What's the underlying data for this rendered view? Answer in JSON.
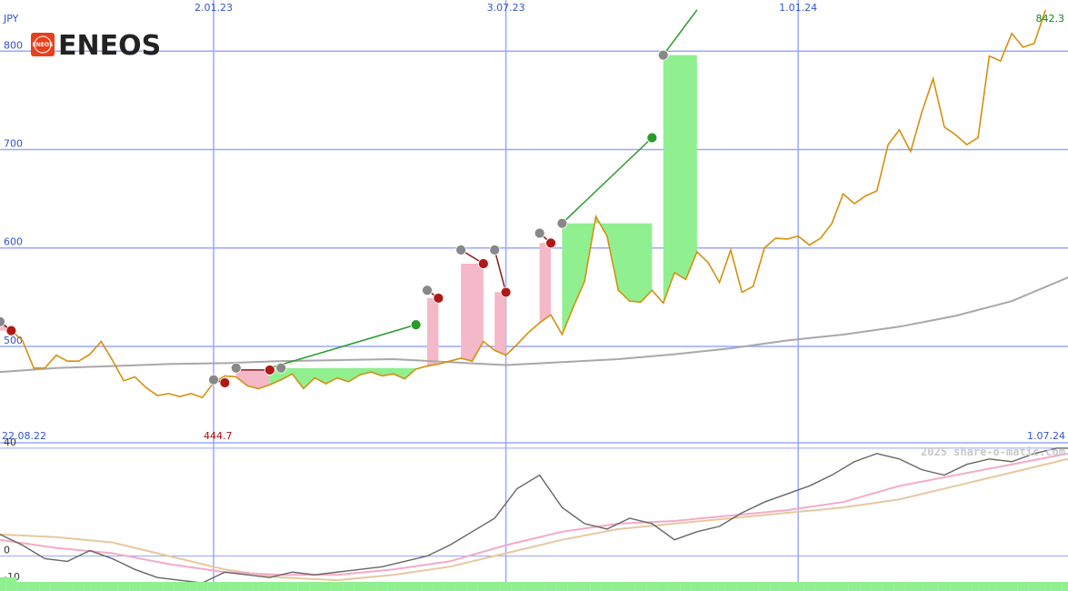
{
  "logo": {
    "badge_text": "ENEOS",
    "wordmark": "ENEOS",
    "badge_color": "#e8401c"
  },
  "currency": "JPY",
  "watermark": "2025 share-o-matic.com",
  "colors": {
    "price": "#d4900e",
    "ma_slow": "#a8a8a8",
    "grid": "#98a8ff",
    "gain_fill": "#90f090",
    "loss_fill": "#f4b8c8",
    "trend_up": "#2a9a2a",
    "trend_down": "#8b1a1a",
    "marker_gray": "#888888",
    "marker_red": "#b01818",
    "marker_green": "#2a9a2a",
    "osc_line": "#666666",
    "osc_pink": "#f4aac8",
    "osc_tan": "#e6c8a0",
    "volume": "#90f090"
  },
  "chart_data": [
    {
      "type": "line",
      "title": "",
      "currency_label": "JPY",
      "x_axis": {
        "start_label": "22.08.22",
        "end_label": "1.07.24",
        "date_ticks": [
          "2.01.23",
          "3.07.23",
          "1.01.24"
        ],
        "date_tick_weeks": [
          19,
          45,
          71
        ]
      },
      "y_axis": {
        "ylim": [
          402,
          852
        ],
        "ticks": [
          500,
          600,
          700,
          800
        ]
      },
      "high_label": "842.3",
      "low_label": "444.7",
      "series": [
        {
          "name": "",
          "role": "price",
          "weeks": [
            0,
            1,
            2,
            3,
            4,
            5,
            6,
            7,
            8,
            9,
            10,
            11,
            12,
            13,
            14,
            15,
            16,
            17,
            18,
            19,
            20,
            21,
            22,
            23,
            24,
            25,
            26,
            27,
            28,
            29,
            30,
            31,
            32,
            33,
            34,
            35,
            36,
            37,
            38,
            39,
            40,
            41,
            42,
            43,
            44,
            45,
            46,
            47,
            48,
            49,
            50,
            51,
            52,
            53,
            54,
            55,
            56,
            57,
            58,
            59,
            60,
            61,
            62,
            63,
            64,
            65,
            66,
            67,
            68,
            69,
            70,
            71,
            72,
            73,
            74,
            75,
            76,
            77,
            78,
            79,
            80,
            81,
            82,
            83,
            84,
            85,
            86,
            87,
            88,
            89,
            90,
            91,
            92,
            93,
            94,
            95
          ],
          "values": [
            525,
            516,
            506,
            478,
            478,
            491,
            485,
            485,
            492,
            505,
            486,
            465,
            469,
            458,
            450,
            452,
            449,
            452,
            448,
            463,
            470,
            469,
            460,
            457,
            461,
            466,
            472,
            457,
            468,
            462,
            468,
            464,
            471,
            474,
            470,
            472,
            467,
            477,
            480,
            482,
            485,
            488,
            485,
            505,
            496,
            491,
            502,
            514,
            524,
            532,
            512,
            540,
            566,
            632,
            612,
            557,
            546,
            545,
            557,
            544,
            575,
            568,
            596,
            585,
            565,
            598,
            555,
            561,
            600,
            610,
            609,
            612,
            603,
            610,
            625,
            655,
            645,
            653,
            658,
            705,
            720,
            698,
            738,
            772,
            723,
            715,
            705,
            712,
            795,
            790,
            818,
            804,
            808,
            842
          ]
        },
        {
          "name": "",
          "role": "moving_average",
          "weeks": [
            0,
            5,
            10,
            15,
            20,
            25,
            30,
            35,
            40,
            45,
            50,
            55,
            60,
            65,
            70,
            75,
            80,
            85,
            90,
            95
          ],
          "values": [
            474,
            478,
            480,
            482,
            483,
            485,
            486,
            487,
            484,
            481,
            484,
            487,
            492,
            498,
            506,
            512,
            520,
            531,
            546,
            570
          ]
        }
      ],
      "trend_segments": [
        {
          "from_week": 0,
          "from": 525,
          "to_week": 1,
          "to": 516,
          "direction": "down"
        },
        {
          "from_week": 19,
          "from": 466,
          "to_week": 20,
          "to": 463,
          "direction": "down"
        },
        {
          "from_week": 21,
          "from": 476,
          "to_week": 24,
          "to": 476,
          "direction": "down"
        },
        {
          "from_week": 24,
          "from": 478,
          "to_week": 37,
          "to": 522,
          "direction": "up"
        },
        {
          "from_week": 38,
          "from": 557,
          "to_week": 39,
          "to": 549,
          "direction": "down"
        },
        {
          "from_week": 41,
          "from": 598,
          "to_week": 43,
          "to": 584,
          "direction": "down"
        },
        {
          "from_week": 44,
          "from": 598,
          "to_week": 45,
          "to": 555,
          "direction": "down"
        },
        {
          "from_week": 48,
          "from": 615,
          "to_week": 49,
          "to": 605,
          "direction": "down"
        },
        {
          "from_week": 50,
          "from": 625,
          "to_week": 58,
          "to": 712,
          "direction": "up"
        },
        {
          "from_week": 59,
          "from": 796,
          "to_week": 62,
          "to": 842,
          "direction": "up"
        }
      ],
      "markers": [
        {
          "week": 0,
          "value": 525,
          "kind": "gray"
        },
        {
          "week": 1,
          "value": 516,
          "kind": "red"
        },
        {
          "week": 19,
          "value": 466,
          "kind": "gray"
        },
        {
          "week": 20,
          "value": 463,
          "kind": "red"
        },
        {
          "week": 21,
          "value": 478,
          "kind": "gray"
        },
        {
          "week": 24,
          "value": 476,
          "kind": "red"
        },
        {
          "week": 25,
          "value": 478,
          "kind": "gray"
        },
        {
          "week": 37,
          "value": 522,
          "kind": "green"
        },
        {
          "week": 38,
          "value": 557,
          "kind": "gray"
        },
        {
          "week": 39,
          "value": 549,
          "kind": "red"
        },
        {
          "week": 41,
          "value": 598,
          "kind": "gray"
        },
        {
          "week": 43,
          "value": 584,
          "kind": "red"
        },
        {
          "week": 44,
          "value": 598,
          "kind": "gray"
        },
        {
          "week": 45,
          "value": 555,
          "kind": "red"
        },
        {
          "week": 48,
          "value": 615,
          "kind": "gray"
        },
        {
          "week": 49,
          "value": 605,
          "kind": "red"
        },
        {
          "week": 50,
          "value": 625,
          "kind": "gray"
        },
        {
          "week": 58,
          "value": 712,
          "kind": "green"
        },
        {
          "week": 59,
          "value": 796,
          "kind": "gray"
        }
      ]
    },
    {
      "type": "line",
      "title": "",
      "y_axis": {
        "ylim": [
          -13,
          42
        ],
        "ticks": [
          40,
          0,
          -10
        ]
      },
      "series": [
        {
          "name": "",
          "role": "oscillator",
          "weeks": [
            0,
            2,
            4,
            6,
            8,
            10,
            12,
            14,
            16,
            18,
            20,
            22,
            24,
            26,
            28,
            30,
            32,
            34,
            36,
            38,
            40,
            42,
            44,
            46,
            48,
            50,
            52,
            54,
            56,
            58,
            60,
            62,
            64,
            66,
            68,
            70,
            72,
            74,
            76,
            78,
            80,
            82,
            84,
            86,
            88,
            90,
            92,
            94,
            95
          ],
          "values": [
            8,
            4,
            -1,
            -2,
            2,
            -1,
            -5,
            -8,
            -9,
            -10,
            -6,
            -7,
            -8,
            -6,
            -7,
            -6,
            -5,
            -4,
            -2,
            0,
            4,
            9,
            14,
            25,
            30,
            18,
            12,
            10,
            14,
            12,
            6,
            9,
            11,
            16,
            20,
            23,
            26,
            30,
            35,
            38,
            36,
            32,
            30,
            34,
            36,
            35,
            38,
            40,
            40
          ]
        },
        {
          "name": "",
          "role": "oscillator_signal_fast",
          "weeks": [
            0,
            5,
            10,
            15,
            20,
            25,
            30,
            35,
            40,
            45,
            50,
            55,
            60,
            65,
            70,
            75,
            80,
            85,
            90,
            95
          ],
          "values": [
            6,
            3,
            1,
            -3,
            -6,
            -7,
            -7,
            -5,
            -2,
            4,
            9,
            12,
            13,
            15,
            17,
            20,
            26,
            30,
            34,
            38
          ]
        },
        {
          "name": "",
          "role": "oscillator_signal_slow",
          "weeks": [
            0,
            5,
            10,
            15,
            20,
            25,
            30,
            35,
            40,
            45,
            50,
            55,
            60,
            65,
            70,
            75,
            80,
            85,
            90,
            95
          ],
          "values": [
            8,
            7,
            5,
            0,
            -5,
            -8,
            -9,
            -7,
            -4,
            1,
            6,
            10,
            12,
            14,
            16,
            18,
            21,
            26,
            31,
            36
          ]
        }
      ],
      "volume": [
        2,
        2,
        1,
        1,
        1,
        1,
        1,
        1,
        1,
        1,
        1,
        1,
        1,
        1,
        1,
        1,
        1,
        1,
        1,
        1,
        1,
        1,
        1,
        1,
        1,
        1,
        1,
        1,
        1,
        1,
        1,
        1,
        1,
        1,
        1,
        1,
        1,
        1,
        1,
        1,
        1,
        1,
        1,
        1,
        1,
        1,
        1,
        1,
        1,
        1,
        1,
        1,
        1,
        1,
        1,
        1,
        1,
        1,
        1,
        1,
        1,
        1,
        1,
        1,
        1,
        1,
        1,
        1,
        1,
        1,
        1,
        1,
        1,
        1,
        1,
        1,
        1,
        1,
        1,
        1,
        1,
        1,
        1,
        1,
        1,
        1,
        1,
        1,
        1,
        1,
        1,
        1,
        1,
        1,
        1,
        1
      ]
    }
  ]
}
